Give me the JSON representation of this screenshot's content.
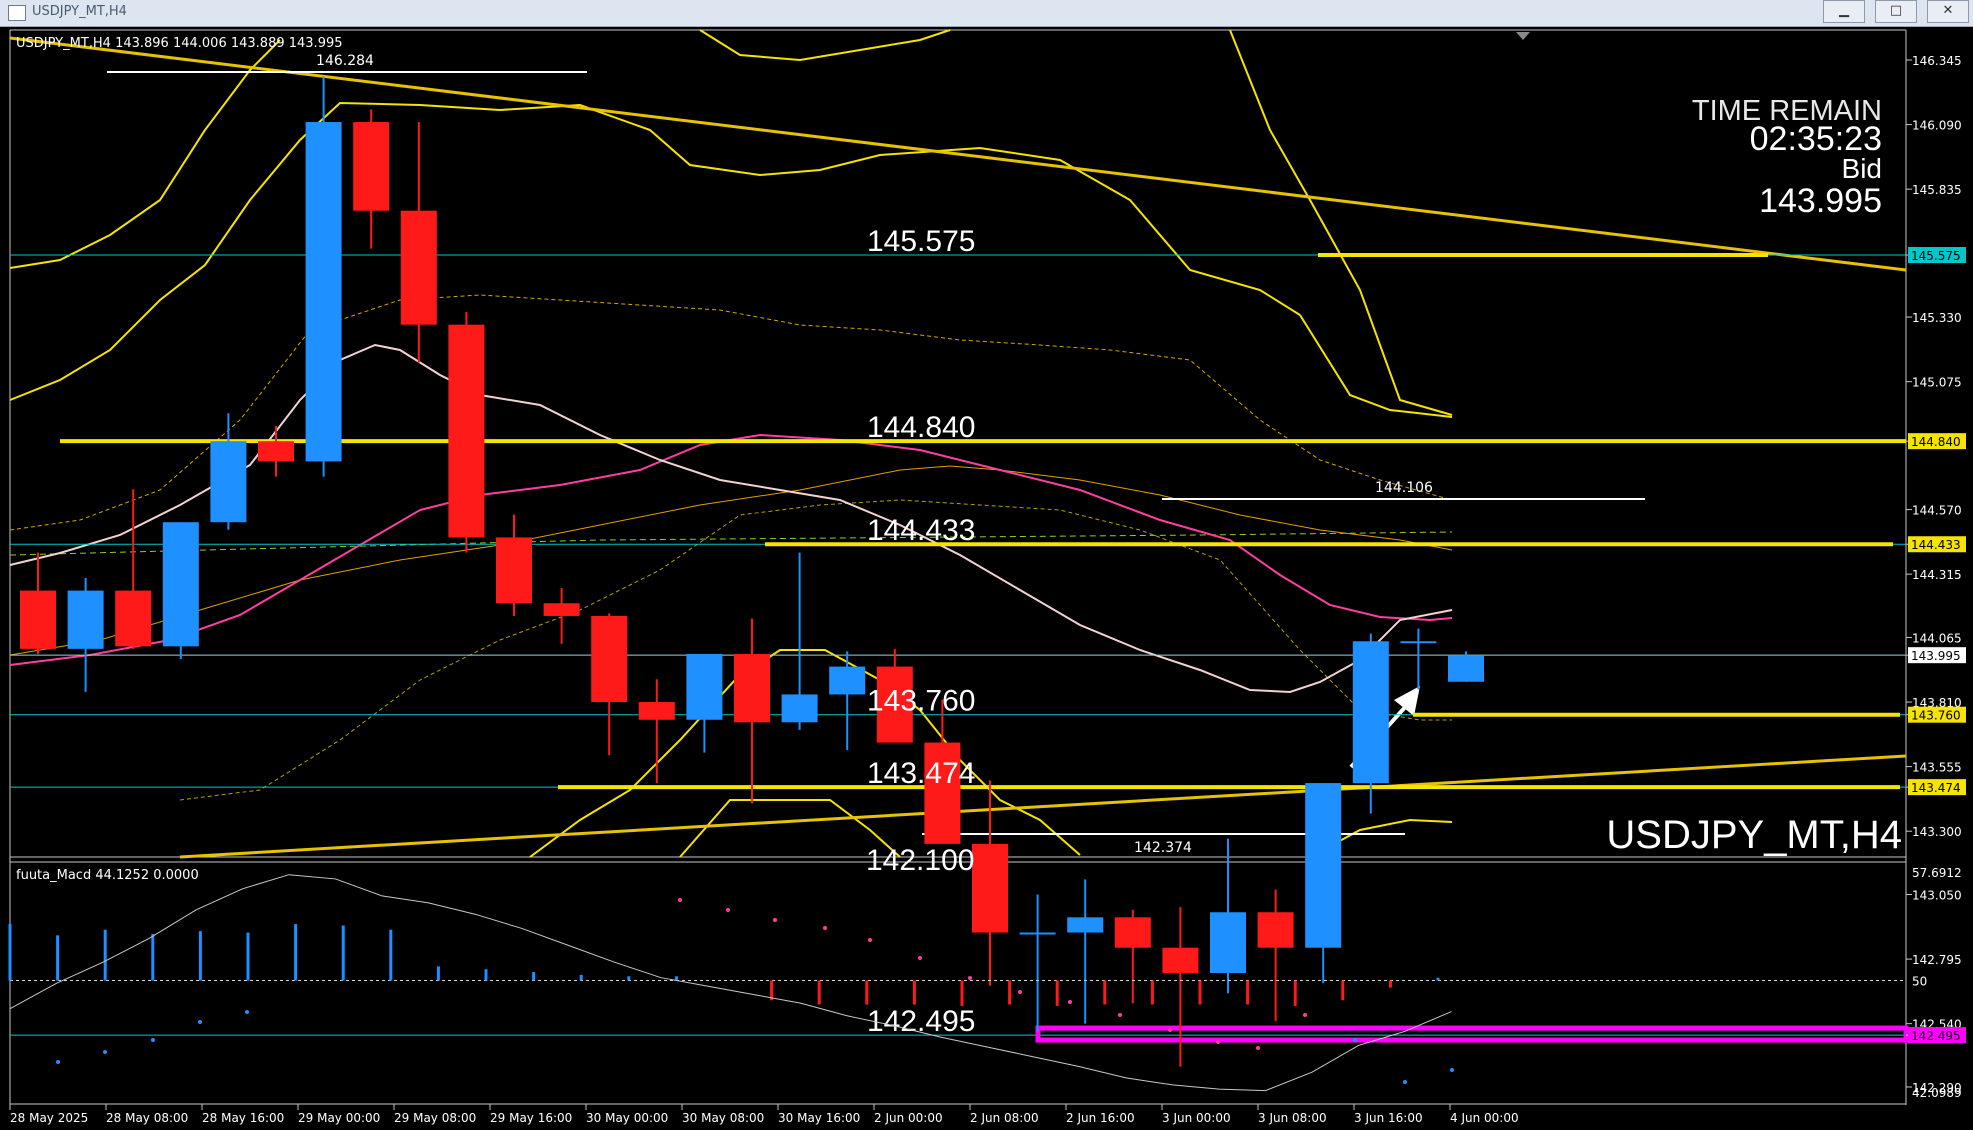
{
  "window": {
    "title": "USDJPY_MT,H4",
    "buttons": [
      {
        "name": "minimize",
        "glyph": "▁"
      },
      {
        "name": "restore",
        "glyph": "□"
      },
      {
        "name": "close",
        "glyph": "✕"
      }
    ]
  },
  "main_chart": {
    "header": "USDJPY_MT,H4  143.896 144.006 143.889 143.995",
    "watermark": "USDJPY_MT,H4",
    "time_remain_label": "TIME REMAIN",
    "time_remain_value": "02:35:23",
    "bid_label": "Bid",
    "bid_value": "143.995",
    "price_axis": [
      "146.345",
      "146.090",
      "145.835",
      "145.575",
      "145.330",
      "145.075",
      "144.840",
      "144.570",
      "144.433",
      "144.315",
      "144.065",
      "143.995",
      "143.810",
      "143.760",
      "143.555",
      "143.474",
      "143.300",
      "143.050",
      "142.795",
      "142.540",
      "142.495",
      "142.290"
    ],
    "level_labels": [
      {
        "text": "145.575",
        "value": 145.575
      },
      {
        "text": "144.840",
        "value": 144.84
      },
      {
        "text": "144.433",
        "value": 144.433
      },
      {
        "text": "143.760",
        "value": 143.76
      },
      {
        "text": "143.474",
        "value": 143.474
      },
      {
        "text": "142.495",
        "value": 142.495
      }
    ],
    "cutoff_level_label": "142.100",
    "swing_labels": [
      {
        "text": "146.284",
        "value": 146.284
      },
      {
        "text": "144.106",
        "value": 144.106
      },
      {
        "text": "142.374",
        "value": 142.374
      }
    ],
    "tags": [
      {
        "text": "145.575",
        "value": 145.575,
        "color": "#00c8c8"
      },
      {
        "text": "144.840",
        "value": 144.84,
        "color": "#f5e400"
      },
      {
        "text": "144.433",
        "value": 144.433,
        "color": "#f5e400"
      },
      {
        "text": "143.995",
        "value": 143.995,
        "color": "#ffffff"
      },
      {
        "text": "143.760",
        "value": 143.76,
        "color": "#f5e400"
      },
      {
        "text": "143.474",
        "value": 143.474,
        "color": "#f5e400"
      },
      {
        "text": "142.495",
        "value": 142.495,
        "color": "#ff00ff"
      }
    ]
  },
  "macd": {
    "header": "fuuta_Macd 44.1252  0.0000",
    "axis_labels": [
      "57.6912",
      "50",
      "42.0989"
    ]
  },
  "time_axis": [
    "28 May 2025",
    "28 May 08:00",
    "28 May 16:00",
    "29 May 00:00",
    "29 May 08:00",
    "29 May 16:00",
    "30 May 00:00",
    "30 May 08:00",
    "30 May 16:00",
    "2 Jun 00:00",
    "2 Jun 08:00",
    "2 Jun 16:00",
    "3 Jun 00:00",
    "3 Jun 08:00",
    "3 Jun 16:00",
    "4 Jun 00:00"
  ],
  "colors": {
    "bull": "#1e90ff",
    "bear": "#ff1a1a",
    "level_line": "#f5e400",
    "grid_cyan": "#00c8c8",
    "support": "#ff00ff",
    "trend": "#e6c200"
  },
  "chart_data": {
    "type": "candlestick",
    "title": "USDJPY_MT,H4",
    "ylim": [
      142.29,
      146.345
    ],
    "x": [
      "28 May 2025 00:00",
      "28 May 04:00",
      "28 May 08:00",
      "28 May 12:00",
      "28 May 16:00",
      "28 May 20:00",
      "29 May 00:00",
      "29 May 04:00",
      "29 May 08:00",
      "29 May 12:00",
      "29 May 16:00",
      "29 May 20:00",
      "30 May 00:00",
      "30 May 04:00",
      "30 May 08:00",
      "30 May 12:00",
      "30 May 16:00",
      "30 May 20:00",
      "2 Jun 00:00",
      "2 Jun 04:00",
      "2 Jun 08:00",
      "2 Jun 12:00",
      "2 Jun 16:00",
      "2 Jun 20:00",
      "3 Jun 00:00",
      "3 Jun 04:00",
      "3 Jun 08:00",
      "3 Jun 12:00",
      "3 Jun 16:00",
      "3 Jun 20:00",
      "4 Jun 00:00"
    ],
    "open": [
      144.25,
      144.02,
      144.25,
      144.03,
      144.52,
      144.84,
      144.76,
      146.1,
      145.75,
      145.3,
      144.46,
      144.2,
      144.15,
      143.81,
      143.74,
      144.0,
      143.73,
      143.84,
      143.95,
      143.65,
      143.25,
      142.9,
      142.9,
      142.96,
      142.84,
      142.74,
      142.98,
      142.84,
      143.49,
      144.05,
      143.89
    ],
    "high": [
      144.4,
      144.3,
      144.65,
      144.35,
      144.95,
      144.9,
      146.28,
      146.15,
      146.1,
      145.35,
      144.55,
      144.26,
      144.16,
      143.9,
      143.98,
      144.14,
      144.4,
      144.01,
      144.02,
      143.82,
      143.5,
      143.05,
      143.11,
      142.99,
      143.0,
      143.27,
      143.07,
      143.49,
      144.08,
      144.1,
      144.01
    ],
    "low": [
      144.0,
      143.85,
      144.02,
      143.98,
      144.49,
      144.7,
      144.7,
      145.6,
      145.15,
      144.4,
      144.15,
      144.04,
      143.6,
      143.49,
      143.61,
      143.41,
      143.7,
      143.62,
      143.7,
      143.3,
      142.69,
      142.51,
      142.54,
      142.62,
      142.37,
      142.66,
      142.55,
      142.7,
      143.37,
      143.86,
      143.89
    ],
    "close": [
      144.02,
      144.25,
      144.03,
      144.52,
      144.84,
      144.76,
      146.1,
      145.75,
      145.3,
      144.46,
      144.2,
      144.15,
      143.81,
      143.74,
      144.0,
      143.73,
      143.84,
      143.95,
      143.65,
      143.25,
      142.9,
      142.9,
      142.96,
      142.84,
      142.74,
      142.98,
      142.84,
      143.49,
      144.05,
      144.05,
      143.995
    ],
    "levels": [
      145.575,
      144.84,
      144.433,
      143.76,
      143.474,
      142.495
    ],
    "bid": 143.995,
    "macd_ylim": [
      42.0989,
      57.6912
    ],
    "macd_hist": [
      54.0,
      53.2,
      53.6,
      53.3,
      53.5,
      53.4,
      54.0,
      53.9,
      53.6,
      51.0,
      50.8,
      50.6,
      50.4,
      50.3,
      50.3,
      50.0,
      48.6,
      48.3,
      48.3,
      48.3,
      48.2,
      48.3,
      48.2,
      48.3,
      48.3,
      48.3,
      48.3,
      48.2,
      48.6,
      49.5,
      50.2,
      50.8,
      51.5,
      52.3
    ],
    "macd_line": [
      48.0,
      49.8,
      51.3,
      53.0,
      55.0,
      56.5,
      57.5,
      57.2,
      56.0,
      55.5,
      54.7,
      53.7,
      52.5,
      51.3,
      50.2,
      49.6,
      49.0,
      48.4,
      47.5,
      46.8,
      46.0,
      45.3,
      44.6,
      43.9,
      43.1,
      42.6,
      42.3,
      42.2,
      43.5,
      45.4,
      46.4,
      47.8
    ]
  }
}
